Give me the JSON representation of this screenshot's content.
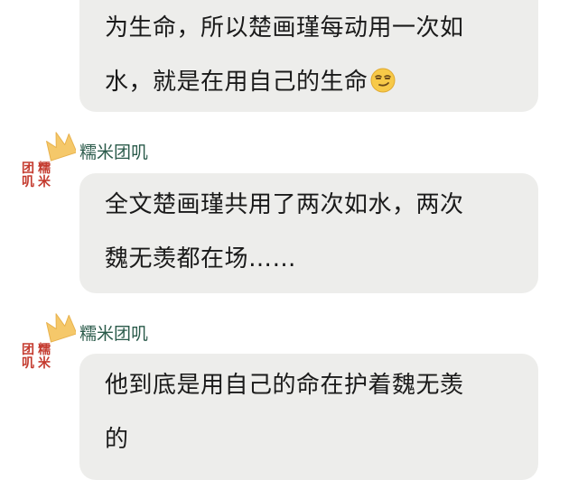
{
  "messages": [
    {
      "lines": [
        "为生命，所以楚画瑾每动用一次如",
        "水，就是在用自己的生命"
      ],
      "emoji": "smirk-emoji"
    },
    {
      "sender": "糯米团叽",
      "lines": [
        "全文楚画瑾共用了两次如水，两次",
        "魏无羡都在场……"
      ]
    },
    {
      "sender": "糯米团叽",
      "lines": [
        "他到底是用自己的命在护着魏无羡",
        "的"
      ]
    }
  ],
  "avatar_seal": [
    "团",
    "糯",
    "叽",
    "米"
  ],
  "colors": {
    "bubble": "#ededeb",
    "sender_name": "#2a5a4a",
    "crown": "#f5c86a",
    "seal": "#c43a2e"
  }
}
